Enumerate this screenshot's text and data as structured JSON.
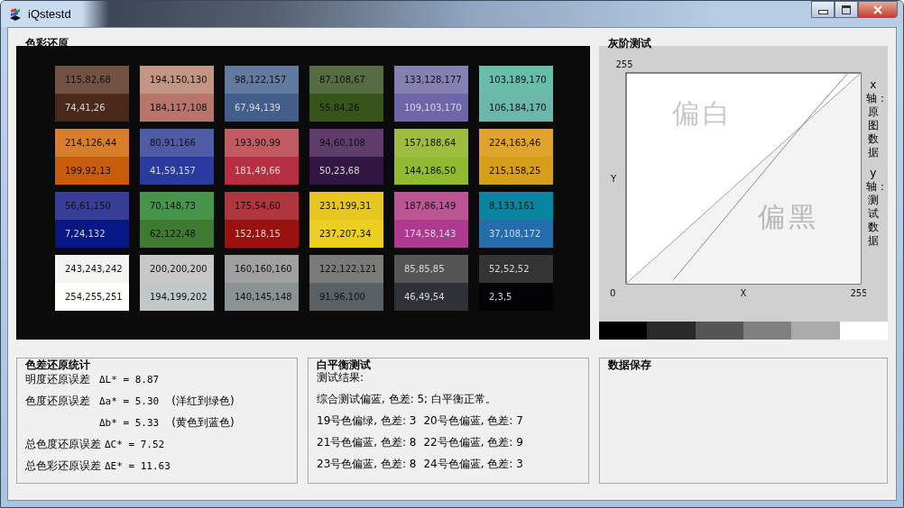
{
  "window": {
    "title": "iQstestd"
  },
  "color_panel": {
    "title": "色彩还原",
    "patches": [
      {
        "top": {
          "text": "115,82,68",
          "color": "#735244",
          "light_text": false
        },
        "bottom": {
          "text": "74,41,26",
          "color": "#4a291a",
          "light_text": true
        }
      },
      {
        "top": {
          "text": "194,150,130",
          "color": "#c29682",
          "light_text": false
        },
        "bottom": {
          "text": "184,117,108",
          "color": "#b8756c",
          "light_text": false
        }
      },
      {
        "top": {
          "text": "98,122,157",
          "color": "#627a9d",
          "light_text": false
        },
        "bottom": {
          "text": "67,94,139",
          "color": "#435e8b",
          "light_text": true
        }
      },
      {
        "top": {
          "text": "87,108,67",
          "color": "#576c43",
          "light_text": false
        },
        "bottom": {
          "text": "55,84,26",
          "color": "#37541a",
          "light_text": false
        }
      },
      {
        "top": {
          "text": "133,128,177",
          "color": "#8580b1",
          "light_text": false
        },
        "bottom": {
          "text": "109,103,170",
          "color": "#6d67aa",
          "light_text": true
        }
      },
      {
        "top": {
          "text": "103,189,170",
          "color": "#67bdaa",
          "light_text": false
        },
        "bottom": {
          "text": "106,184,170",
          "color": "#6ab8aa",
          "light_text": false
        }
      },
      {
        "top": {
          "text": "214,126,44",
          "color": "#d67e2c",
          "light_text": false
        },
        "bottom": {
          "text": "199,92,13",
          "color": "#c75c0d",
          "light_text": false
        }
      },
      {
        "top": {
          "text": "80,91,166",
          "color": "#505ba6",
          "light_text": false
        },
        "bottom": {
          "text": "41,59,157",
          "color": "#293b9d",
          "light_text": true
        }
      },
      {
        "top": {
          "text": "193,90,99",
          "color": "#c15a63",
          "light_text": false
        },
        "bottom": {
          "text": "181,49,66",
          "color": "#b53142",
          "light_text": true
        }
      },
      {
        "top": {
          "text": "94,60,108",
          "color": "#5e3c6c",
          "light_text": false
        },
        "bottom": {
          "text": "50,23,68",
          "color": "#321744",
          "light_text": true
        }
      },
      {
        "top": {
          "text": "157,188,64",
          "color": "#9dbc40",
          "light_text": false
        },
        "bottom": {
          "text": "144,186,50",
          "color": "#90ba32",
          "light_text": false
        }
      },
      {
        "top": {
          "text": "224,163,46",
          "color": "#e0a32e",
          "light_text": false
        },
        "bottom": {
          "text": "215,158,25",
          "color": "#d79e19",
          "light_text": false
        }
      },
      {
        "top": {
          "text": "56,61,150",
          "color": "#383d96",
          "light_text": false
        },
        "bottom": {
          "text": "7,24,132",
          "color": "#071884",
          "light_text": true
        }
      },
      {
        "top": {
          "text": "70,148,73",
          "color": "#469449",
          "light_text": false
        },
        "bottom": {
          "text": "62,122,48",
          "color": "#3e7a30",
          "light_text": false
        }
      },
      {
        "top": {
          "text": "175,54,60",
          "color": "#af363c",
          "light_text": false
        },
        "bottom": {
          "text": "152,18,15",
          "color": "#98120f",
          "light_text": true
        }
      },
      {
        "top": {
          "text": "231,199,31",
          "color": "#e7c71f",
          "light_text": false
        },
        "bottom": {
          "text": "237,207,34",
          "color": "#edcf22",
          "light_text": false
        }
      },
      {
        "top": {
          "text": "187,86,149",
          "color": "#bb5695",
          "light_text": false
        },
        "bottom": {
          "text": "174,58,143",
          "color": "#ae3a8f",
          "light_text": true
        }
      },
      {
        "top": {
          "text": "8,133,161",
          "color": "#0885a1",
          "light_text": false
        },
        "bottom": {
          "text": "37,108,172",
          "color": "#256cac",
          "light_text": true
        }
      },
      {
        "top": {
          "text": "243,243,242",
          "color": "#f3f3f2",
          "light_text": false
        },
        "bottom": {
          "text": "254,255,251",
          "color": "#fefffb",
          "light_text": false
        }
      },
      {
        "top": {
          "text": "200,200,200",
          "color": "#c8c8c8",
          "light_text": false
        },
        "bottom": {
          "text": "194,199,202",
          "color": "#c2c7ca",
          "light_text": false
        }
      },
      {
        "top": {
          "text": "160,160,160",
          "color": "#a0a0a0",
          "light_text": false
        },
        "bottom": {
          "text": "140,145,148",
          "color": "#8c9194",
          "light_text": false
        }
      },
      {
        "top": {
          "text": "122,122,121",
          "color": "#7a7a79",
          "light_text": false
        },
        "bottom": {
          "text": "91,96,100",
          "color": "#5b6064",
          "light_text": false
        }
      },
      {
        "top": {
          "text": "85,85,85",
          "color": "#555555",
          "light_text": true
        },
        "bottom": {
          "text": "46,49,54",
          "color": "#2e3136",
          "light_text": true
        }
      },
      {
        "top": {
          "text": "52,52,52",
          "color": "#343434",
          "light_text": true
        },
        "bottom": {
          "text": "2,3,5",
          "color": "#020305",
          "light_text": true
        }
      }
    ]
  },
  "gray_panel": {
    "title": "灰阶测试",
    "graph": {
      "y_max": "255",
      "y_label": "Y",
      "origin": "0",
      "x_label": "X",
      "x_max": "255",
      "upper_label": "偏白",
      "lower_label": "偏黑"
    },
    "axis_notes": [
      "x轴：原图数据",
      "y轴：测试数据"
    ],
    "gray_steps": [
      {
        "color": "#000000"
      },
      {
        "color": "#2a2a2a"
      },
      {
        "color": "#555555"
      },
      {
        "color": "#808080"
      },
      {
        "color": "#aaaaaa"
      },
      {
        "color": "#ffffff"
      }
    ]
  },
  "color_difference": {
    "title": "色差还原统计",
    "rows": [
      {
        "label": "明度还原误差",
        "formula": "ΔL* = 8.87"
      },
      {
        "label": "色度还原误差",
        "formula": "Δa* = 5.30",
        "note": "(洋红到绿色)"
      },
      {
        "formula": "Δb* = 5.33",
        "note": "(黄色到蓝色)"
      },
      {
        "label": "总色度还原误差",
        "formula": "ΔC* = 7.52"
      },
      {
        "label": "总色彩还原误差",
        "formula": "ΔE* = 11.63"
      }
    ]
  },
  "white_balance": {
    "title": "白平衡测试",
    "heading": "测试结果:",
    "summary": "综合测试偏蓝, 色差: 5; 白平衡正常。",
    "pairs": [
      [
        "19号色偏绿, 色差: 3",
        "20号色偏蓝, 色差: 7"
      ],
      [
        "21号色偏蓝, 色差: 8",
        "22号色偏蓝, 色差: 9"
      ],
      [
        "23号色偏蓝, 色差: 8",
        "24号色偏蓝, 色差: 3"
      ]
    ]
  },
  "data_save": {
    "title": "数据保存"
  }
}
